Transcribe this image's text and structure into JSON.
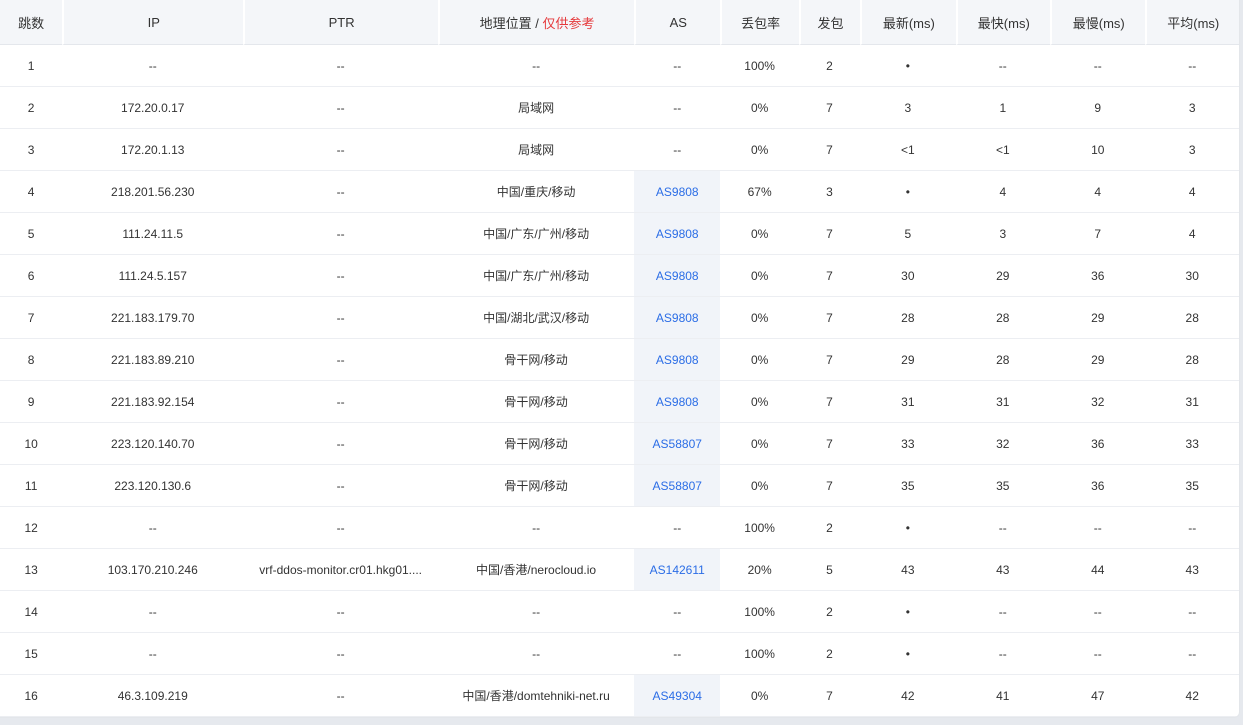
{
  "columns": {
    "hop": "跳数",
    "ip": "IP",
    "ptr": "PTR",
    "geo": "地理位置",
    "geo_sep": "/",
    "geo_note": "仅供参考",
    "as": "AS",
    "loss": "丢包率",
    "sent": "发包",
    "last": "最新(ms)",
    "best": "最快(ms)",
    "worst": "最慢(ms)",
    "avg": "平均(ms)"
  },
  "colors": {
    "link": "#2b6de6",
    "note": "#e5393c",
    "as_bg": "#f1f4f9"
  },
  "rows": [
    {
      "hop": "1",
      "ip": "--",
      "ptr": "--",
      "geo": "--",
      "as": "--",
      "loss": "100%",
      "sent": "2",
      "last": "•",
      "best": "--",
      "worst": "--",
      "avg": "--"
    },
    {
      "hop": "2",
      "ip": "172.20.0.17",
      "ptr": "--",
      "geo": "局域网",
      "as": "--",
      "loss": "0%",
      "sent": "7",
      "last": "3",
      "best": "1",
      "worst": "9",
      "avg": "3"
    },
    {
      "hop": "3",
      "ip": "172.20.1.13",
      "ptr": "--",
      "geo": "局域网",
      "as": "--",
      "loss": "0%",
      "sent": "7",
      "last": "<1",
      "best": "<1",
      "worst": "10",
      "avg": "3"
    },
    {
      "hop": "4",
      "ip": "218.201.56.230",
      "ptr": "--",
      "geo": "中国/重庆/移动",
      "as": "AS9808",
      "loss": "67%",
      "sent": "3",
      "last": "•",
      "best": "4",
      "worst": "4",
      "avg": "4"
    },
    {
      "hop": "5",
      "ip": "111.24.11.5",
      "ptr": "--",
      "geo": "中国/广东/广州/移动",
      "as": "AS9808",
      "loss": "0%",
      "sent": "7",
      "last": "5",
      "best": "3",
      "worst": "7",
      "avg": "4"
    },
    {
      "hop": "6",
      "ip": "111.24.5.157",
      "ptr": "--",
      "geo": "中国/广东/广州/移动",
      "as": "AS9808",
      "loss": "0%",
      "sent": "7",
      "last": "30",
      "best": "29",
      "worst": "36",
      "avg": "30"
    },
    {
      "hop": "7",
      "ip": "221.183.179.70",
      "ptr": "--",
      "geo": "中国/湖北/武汉/移动",
      "as": "AS9808",
      "loss": "0%",
      "sent": "7",
      "last": "28",
      "best": "28",
      "worst": "29",
      "avg": "28"
    },
    {
      "hop": "8",
      "ip": "221.183.89.210",
      "ptr": "--",
      "geo": "骨干网/移动",
      "as": "AS9808",
      "loss": "0%",
      "sent": "7",
      "last": "29",
      "best": "28",
      "worst": "29",
      "avg": "28"
    },
    {
      "hop": "9",
      "ip": "221.183.92.154",
      "ptr": "--",
      "geo": "骨干网/移动",
      "as": "AS9808",
      "loss": "0%",
      "sent": "7",
      "last": "31",
      "best": "31",
      "worst": "32",
      "avg": "31"
    },
    {
      "hop": "10",
      "ip": "223.120.140.70",
      "ptr": "--",
      "geo": "骨干网/移动",
      "as": "AS58807",
      "loss": "0%",
      "sent": "7",
      "last": "33",
      "best": "32",
      "worst": "36",
      "avg": "33"
    },
    {
      "hop": "11",
      "ip": "223.120.130.6",
      "ptr": "--",
      "geo": "骨干网/移动",
      "as": "AS58807",
      "loss": "0%",
      "sent": "7",
      "last": "35",
      "best": "35",
      "worst": "36",
      "avg": "35"
    },
    {
      "hop": "12",
      "ip": "--",
      "ptr": "--",
      "geo": "--",
      "as": "--",
      "loss": "100%",
      "sent": "2",
      "last": "•",
      "best": "--",
      "worst": "--",
      "avg": "--"
    },
    {
      "hop": "13",
      "ip": "103.170.210.246",
      "ptr": "vrf-ddos-monitor.cr01.hkg01....",
      "geo": "中国/香港/nerocloud.io",
      "as": "AS142611",
      "loss": "20%",
      "sent": "5",
      "last": "43",
      "best": "43",
      "worst": "44",
      "avg": "43"
    },
    {
      "hop": "14",
      "ip": "--",
      "ptr": "--",
      "geo": "--",
      "as": "--",
      "loss": "100%",
      "sent": "2",
      "last": "•",
      "best": "--",
      "worst": "--",
      "avg": "--"
    },
    {
      "hop": "15",
      "ip": "--",
      "ptr": "--",
      "geo": "--",
      "as": "--",
      "loss": "100%",
      "sent": "2",
      "last": "•",
      "best": "--",
      "worst": "--",
      "avg": "--"
    },
    {
      "hop": "16",
      "ip": "46.3.109.219",
      "ptr": "--",
      "geo": "中国/香港/domtehniki-net.ru",
      "as": "AS49304",
      "loss": "0%",
      "sent": "7",
      "last": "42",
      "best": "41",
      "worst": "47",
      "avg": "42"
    }
  ]
}
